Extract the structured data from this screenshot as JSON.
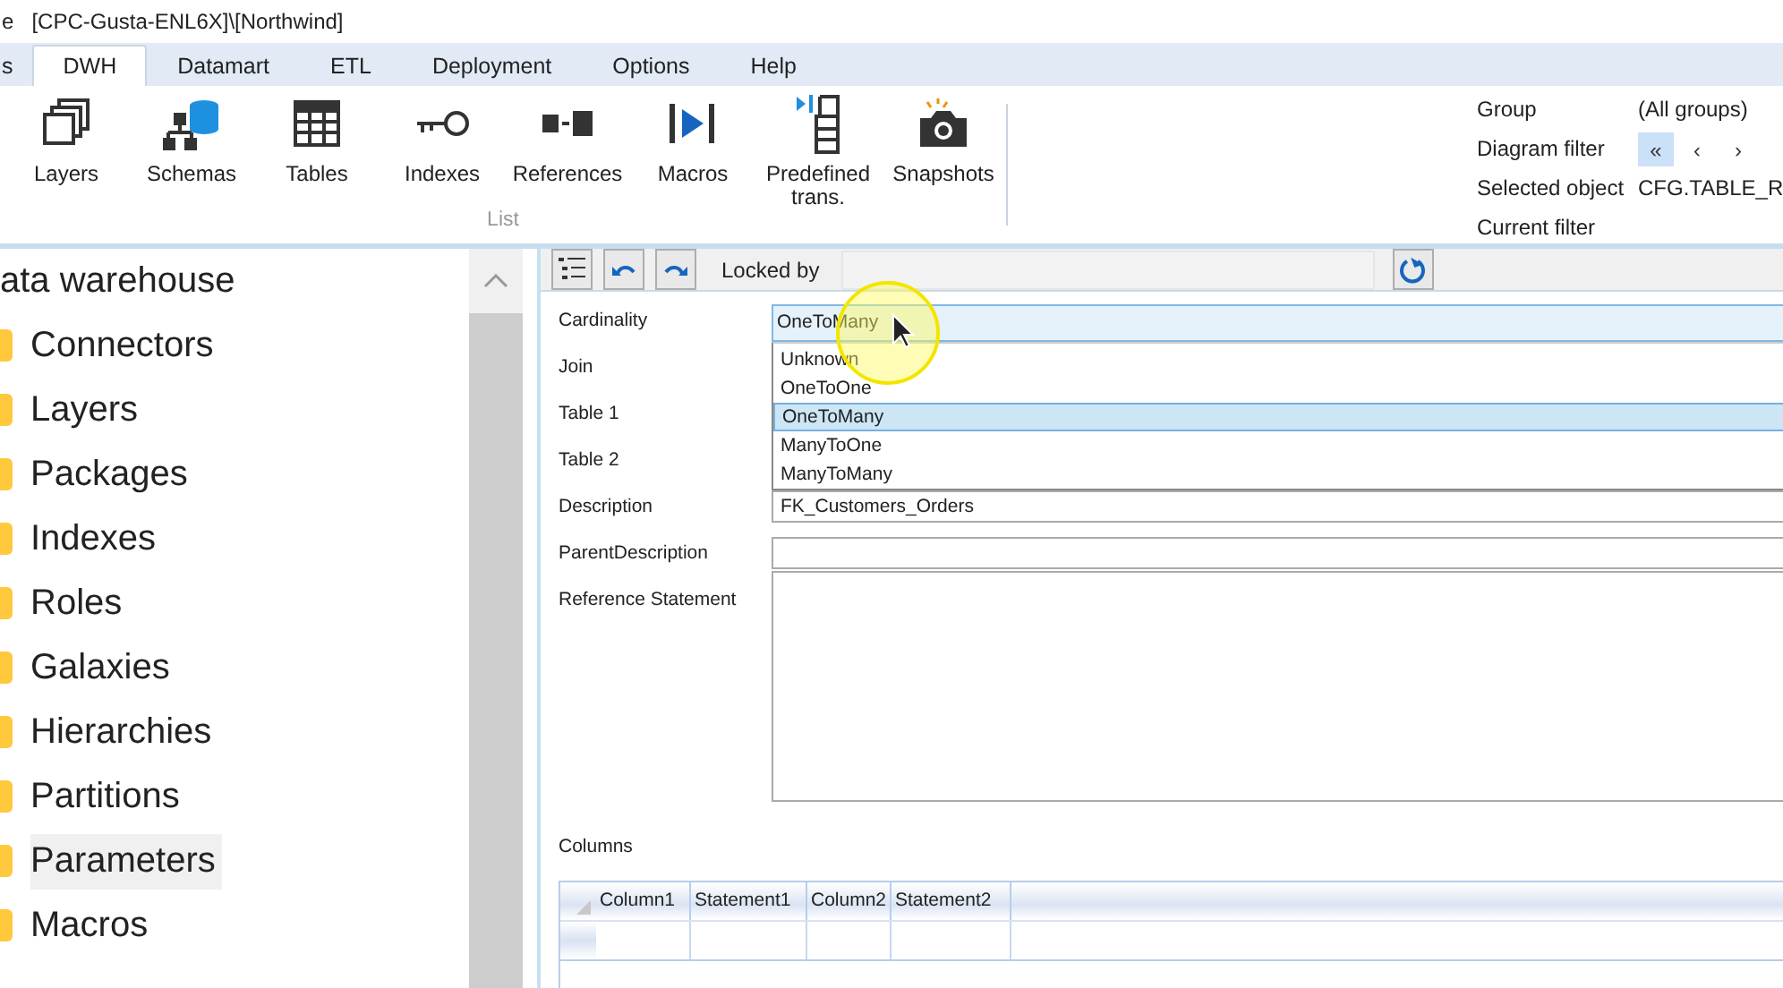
{
  "window": {
    "title_fragment": "e",
    "title": "[CPC-Gusta-ENL6X]\\[Northwind]"
  },
  "ribbon_tabs": [
    {
      "label": "s",
      "selected": false
    },
    {
      "label": "DWH",
      "selected": true
    },
    {
      "label": "Datamart",
      "selected": false
    },
    {
      "label": "ETL",
      "selected": false
    },
    {
      "label": "Deployment",
      "selected": false
    },
    {
      "label": "Options",
      "selected": false
    },
    {
      "label": "Help",
      "selected": false
    }
  ],
  "ribbon": {
    "buttons": [
      {
        "label": "Layers"
      },
      {
        "label": "Schemas"
      },
      {
        "label": "Tables"
      },
      {
        "label": "Indexes"
      },
      {
        "label": "References"
      },
      {
        "label": "Macros"
      },
      {
        "label": "Predefined trans."
      },
      {
        "label": "Snapshots"
      }
    ],
    "group_label": "List",
    "filters": [
      {
        "label": "Group",
        "kind": "text",
        "value": "(All groups)"
      },
      {
        "label": "Diagram filter",
        "kind": "nav",
        "buttons": [
          {
            "label": "«",
            "selected": true
          },
          {
            "label": "‹",
            "selected": false
          },
          {
            "label": "›",
            "selected": false
          }
        ]
      },
      {
        "label": "Selected object",
        "kind": "text",
        "value": "CFG.TABLE_R"
      },
      {
        "label": "Current filter",
        "kind": "text"
      }
    ]
  },
  "tree": {
    "root": "ata warehouse",
    "children": [
      {
        "label": "Connectors",
        "selected": false
      },
      {
        "label": "Layers",
        "selected": false
      },
      {
        "label": "Packages",
        "selected": false
      },
      {
        "label": "Indexes",
        "selected": false
      },
      {
        "label": "Roles",
        "selected": false
      },
      {
        "label": "Galaxies",
        "selected": false
      },
      {
        "label": "Hierarchies",
        "selected": false
      },
      {
        "label": "Partitions",
        "selected": false
      },
      {
        "label": "Parameters",
        "selected": true
      },
      {
        "label": "Macros",
        "selected": false
      }
    ]
  },
  "toolbar": {
    "locked_by_label": "Locked by"
  },
  "form": {
    "fields": [
      {
        "label": "Cardinality",
        "kind": "combo",
        "value": "OneToMany",
        "expanded": true,
        "options": [
          {
            "label": "Unknown",
            "selected": false
          },
          {
            "label": "OneToOne",
            "selected": false
          },
          {
            "label": "OneToMany",
            "selected": true
          },
          {
            "label": "ManyToOne",
            "selected": false
          },
          {
            "label": "ManyToMany",
            "selected": false
          }
        ]
      },
      {
        "label": "Join",
        "kind": "covered"
      },
      {
        "label": "Table 1",
        "kind": "covered"
      },
      {
        "label": "Table 2",
        "kind": "covered"
      },
      {
        "label": "Description",
        "kind": "text",
        "value": "FK_Customers_Orders"
      },
      {
        "label": "ParentDescription",
        "kind": "text"
      },
      {
        "label": "Reference Statement",
        "kind": "textarea"
      }
    ],
    "columns_label": "Columns",
    "grid_columns": [
      "Column1",
      "Statement1",
      "Column2",
      "Statement2"
    ]
  }
}
